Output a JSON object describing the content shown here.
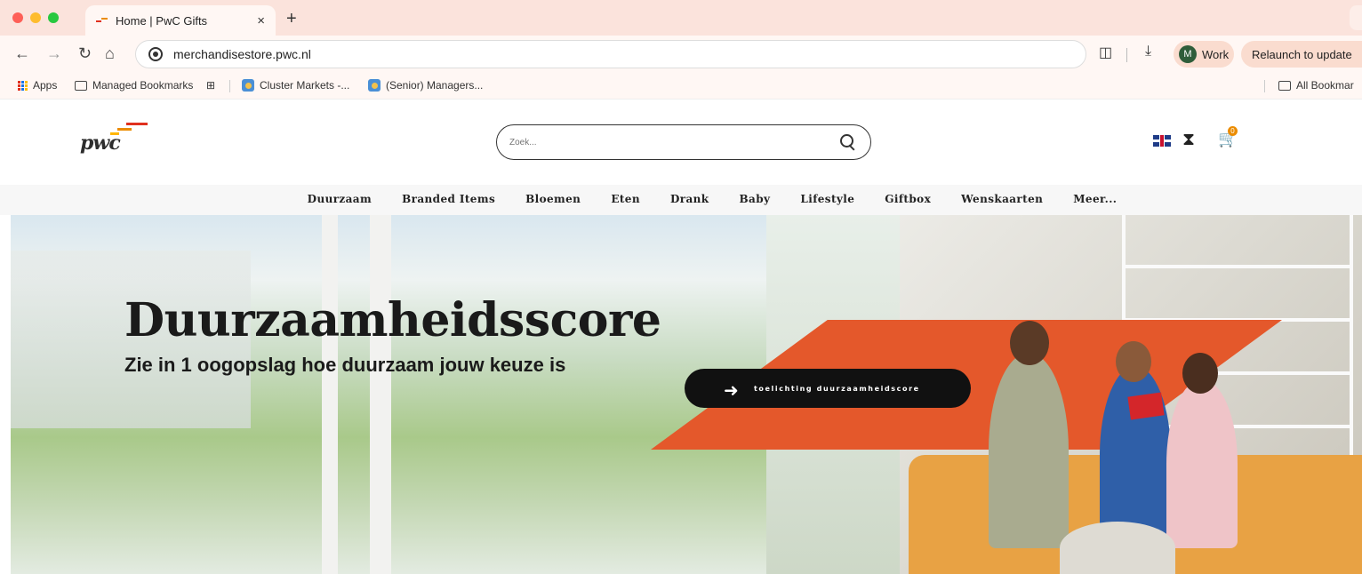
{
  "browser": {
    "tab_title": "Home | PwC Gifts",
    "tab_close": "×",
    "new_tab": "+",
    "url": "merchandisestore.pwc.nl",
    "profile_initial": "M",
    "profile_label": "Work",
    "relaunch_label": "Relaunch to update",
    "bookmarks": {
      "apps": "Apps",
      "managed": "Managed Bookmarks",
      "cluster": "Cluster Markets -...",
      "senior": "(Senior) Managers...",
      "all": "All Bookmar"
    }
  },
  "header": {
    "logo_text": "pwc",
    "search_placeholder": "Zoek...",
    "cart_count": "0",
    "icons": [
      "uk-flag-icon",
      "support-icon",
      "cart-icon"
    ]
  },
  "nav": {
    "items": [
      "Duurzaam",
      "Branded Items",
      "Bloemen",
      "Eten",
      "Drank",
      "Baby",
      "Lifestyle",
      "Giftbox",
      "Wenskaarten",
      "Meer..."
    ]
  },
  "hero": {
    "title": "Duurzaamheidsscore",
    "subtitle": "Zie in 1 oogopslag hoe duurzaam jouw keuze is",
    "cta_label": "toelichting duurzaamheidscore"
  },
  "colors": {
    "accent_orange": "#e4582b",
    "tabbar_bg": "#fbe3dc",
    "cta_bg": "#111111"
  }
}
